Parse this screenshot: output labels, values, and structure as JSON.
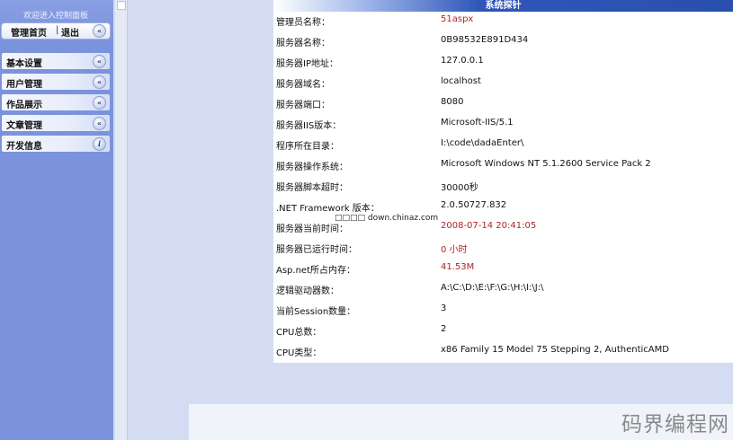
{
  "sidebar": {
    "welcome": "欢迎进入控制面板",
    "home_link": "管理首页",
    "separator": "|",
    "logout_link": "退出",
    "collapse_glyph": "«",
    "info_glyph": "i",
    "items": [
      {
        "label": "基本设置",
        "icon": "collapse-icon"
      },
      {
        "label": "用户管理",
        "icon": "collapse-icon"
      },
      {
        "label": "作品展示",
        "icon": "collapse-icon"
      },
      {
        "label": "文章管理",
        "icon": "collapse-icon"
      },
      {
        "label": "开发信息",
        "icon": "info-icon"
      }
    ]
  },
  "panel": {
    "title": "系统探针",
    "accent": "#2a4fae",
    "rows": [
      {
        "key": "管理员名称：",
        "value": "51aspx",
        "red": true
      },
      {
        "key": "服务器名称：",
        "value": "0B98532E891D434",
        "red": false
      },
      {
        "key": "服务器IP地址：",
        "value": "127.0.0.1",
        "red": false
      },
      {
        "key": "服务器域名：",
        "value": "localhost",
        "red": false
      },
      {
        "key": "服务器端口：",
        "value": "8080",
        "red": false
      },
      {
        "key": "服务器IIS版本：",
        "value": "Microsoft-IIS/5.1",
        "red": false
      },
      {
        "key": "程序所在目录：",
        "value": "I:\\code\\dadaEnter\\",
        "red": false
      },
      {
        "key": "服务器操作系统：",
        "value": "Microsoft Windows NT 5.1.2600 Service Pack 2",
        "red": false
      },
      {
        "key": "服务器脚本超时：",
        "value": "30000秒",
        "red": false
      },
      {
        "key": ".NET Framework 版本：",
        "value": "2.0.50727.832",
        "red": false
      },
      {
        "key": "服务器当前时间：",
        "value": "2008-07-14 20:41:05",
        "red": true
      },
      {
        "key": "服务器已运行时间：",
        "value": "0 小时",
        "red": true
      },
      {
        "key": "Asp.net所占内存：",
        "value": "41.53M",
        "red": true
      },
      {
        "key": "逻辑驱动器数：",
        "value": "A:\\C:\\D:\\E:\\F:\\G:\\H:\\I:\\J:\\",
        "red": false
      },
      {
        "key": "当前Session数量：",
        "value": "3",
        "red": false
      },
      {
        "key": "CPU总数：",
        "value": "2",
        "red": false
      },
      {
        "key": "CPU类型：",
        "value": "x86 Family 15 Model 75 Stepping 2, AuthenticAMD",
        "red": false
      }
    ]
  },
  "watermark": "□□□□ down.chinaz.com",
  "corner_logo": "码界编程网"
}
